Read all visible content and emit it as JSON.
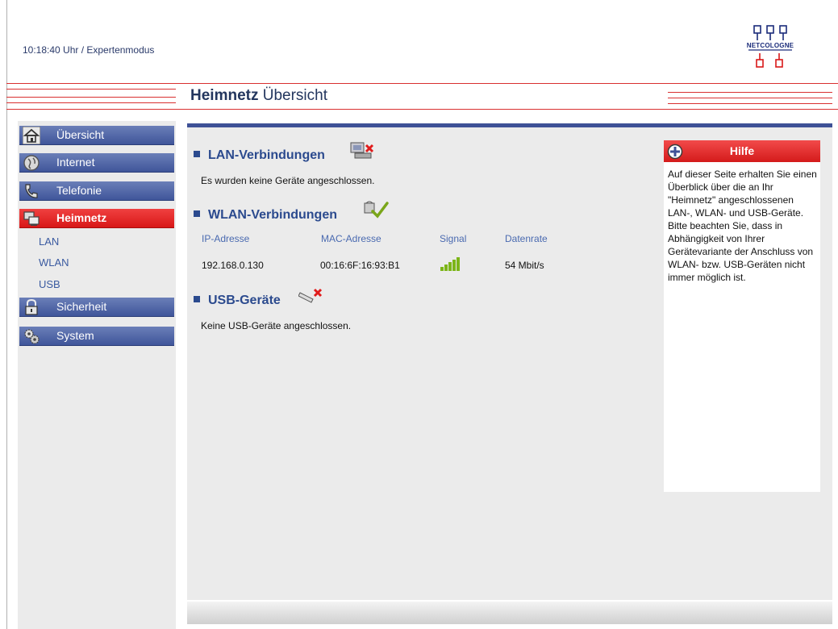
{
  "header": {
    "status": "10:18:40 Uhr  / Expertenmodus",
    "logo_text": "NETCOLOGNE",
    "title_bold": "Heimnetz",
    "title_rest": " Übersicht"
  },
  "colors": {
    "nav_blue": "#3f559a",
    "nav_active_red": "#d81818",
    "accent_red": "#d93030",
    "content_bg": "#ebebeb"
  },
  "sidebar": {
    "items": [
      {
        "label": "Übersicht",
        "icon": "home-icon"
      },
      {
        "label": "Internet",
        "icon": "globe-icon"
      },
      {
        "label": "Telefonie",
        "icon": "phone-icon"
      },
      {
        "label": "Heimnetz",
        "icon": "network-icon",
        "active": true
      },
      {
        "label": "Sicherheit",
        "icon": "lock-icon"
      },
      {
        "label": "System",
        "icon": "gears-icon"
      }
    ],
    "subitems": [
      "LAN",
      "WLAN",
      "USB"
    ]
  },
  "main": {
    "lan": {
      "title": "LAN-Verbindungen",
      "icon": "lan-disconnected-icon",
      "text": "Es wurden keine Geräte angeschlossen."
    },
    "wlan": {
      "title": "WLAN-Verbindungen",
      "icon": "wlan-connected-icon",
      "columns": [
        "IP-Adresse",
        "MAC-Adresse",
        "Signal",
        "Datenrate"
      ],
      "rows": [
        {
          "ip": "192.168.0.130",
          "mac": "00:16:6F:16:93:B1",
          "signal": "signal-bars-icon",
          "rate": "54 Mbit/s"
        }
      ]
    },
    "usb": {
      "title": "USB-Geräte",
      "icon": "usb-disconnected-icon",
      "text": "Keine USB-Geräte angeschlossen."
    }
  },
  "help": {
    "title": "Hilfe",
    "icon": "plus-circle-icon",
    "text": "Auf dieser Seite erhalten Sie einen Überblick über die an Ihr \"Heimnetz\" angeschlossenen LAN-, WLAN- und USB-Geräte. Bitte beachten Sie, dass in Abhängigkeit von Ihrer Gerätevariante der Anschluss von WLAN- bzw. USB-Geräten nicht immer möglich ist."
  }
}
